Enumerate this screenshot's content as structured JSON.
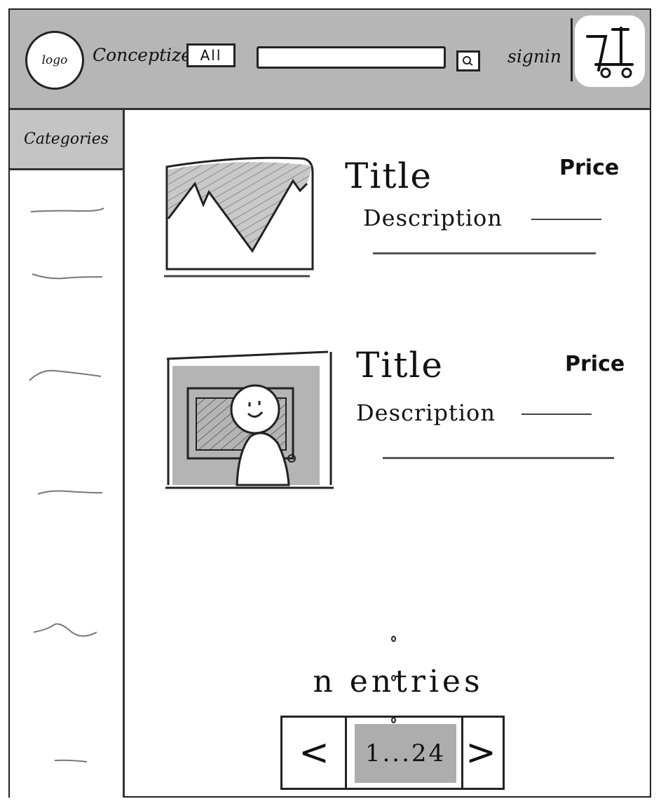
{
  "header": {
    "logo_text": "logo",
    "brand": "Conceptize",
    "category_select": "All",
    "search_value": "",
    "signin_label": "signin",
    "cart_icon": "shopping-cart-icon",
    "search_icon": "search-icon"
  },
  "sidebar": {
    "title": "Categories",
    "items": [
      "",
      "",
      "",
      "",
      "",
      ""
    ]
  },
  "products": [
    {
      "title": "Title",
      "price": "Price",
      "description": "Description",
      "image": "mountain-image"
    },
    {
      "title": "Title",
      "price": "Price",
      "description": "Description",
      "image": "person-image"
    }
  ],
  "list": {
    "more_indicator": "...",
    "entries_label": "n entries"
  },
  "pagination": {
    "prev_label": "<",
    "range_label": "1...24",
    "next_label": ">"
  },
  "colors": {
    "header_bg": "#b6b6b6",
    "sidebar_head_bg": "#c4c4c4",
    "highlight_gray": "#adadad",
    "ink": "#222222"
  }
}
